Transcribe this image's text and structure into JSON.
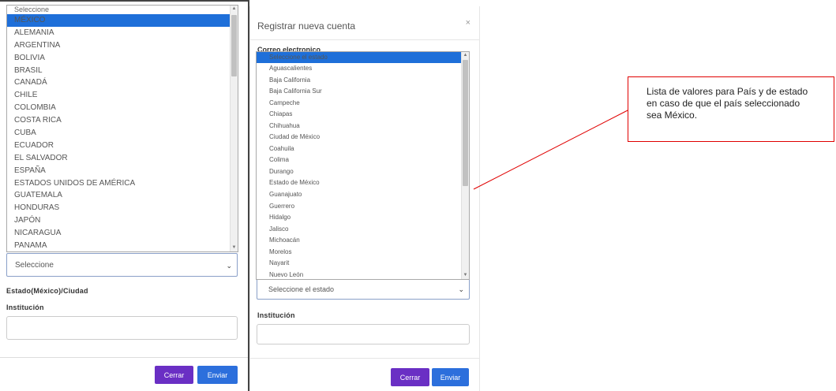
{
  "left_form": {
    "country_options": [
      "Seleccione",
      "MÉXICO",
      "ALEMANIA",
      "ARGENTINA",
      "BOLIVIA",
      "BRASIL",
      "CANADÁ",
      "CHILE",
      "COLOMBIA",
      "COSTA RICA",
      "CUBA",
      "ECUADOR",
      "EL SALVADOR",
      "ESPAÑA",
      "ESTADOS UNIDOS DE AMÉRICA",
      "GUATEMALA",
      "HONDURAS",
      "JAPÓN",
      "NICARAGUA",
      "PANAMA"
    ],
    "country_highlighted": "MÉXICO",
    "country_select_value": "Seleccione",
    "state_label": "Estado(México)/Ciudad",
    "institution_label": "Institución",
    "close_button": "Cerrar",
    "submit_button": "Enviar"
  },
  "modal": {
    "title": "Registrar nueva cuenta",
    "close_icon": "×",
    "email_label": "Correo electronico",
    "state_options": [
      "Seleccione el estado",
      "Aguascalientes",
      "Baja California",
      "Baja California Sur",
      "Campeche",
      "Chiapas",
      "Chihuahua",
      "Ciudad de México",
      "Coahuila",
      "Colima",
      "Durango",
      "Estado de México",
      "Guanajuato",
      "Guerrero",
      "Hidalgo",
      "Jalisco",
      "Michoacán",
      "Morelos",
      "Nayarit",
      "Nuevo León"
    ],
    "state_highlighted": "Seleccione el estado",
    "state_select_value": "Seleccione el estado",
    "institution_label": "Institución",
    "close_button": "Cerrar",
    "submit_button": "Enviar"
  },
  "annotation": {
    "text": "Lista de valores para País y de estado en caso de que el país seleccionado sea México."
  },
  "colors": {
    "highlight": "#1e6fd9",
    "close_button": "#6a2fc4",
    "submit_button": "#2c6fdc",
    "annotation_border": "#e00000"
  },
  "icons": {
    "dropdown_caret": "chevron-down-icon",
    "modal_close": "close-icon"
  }
}
